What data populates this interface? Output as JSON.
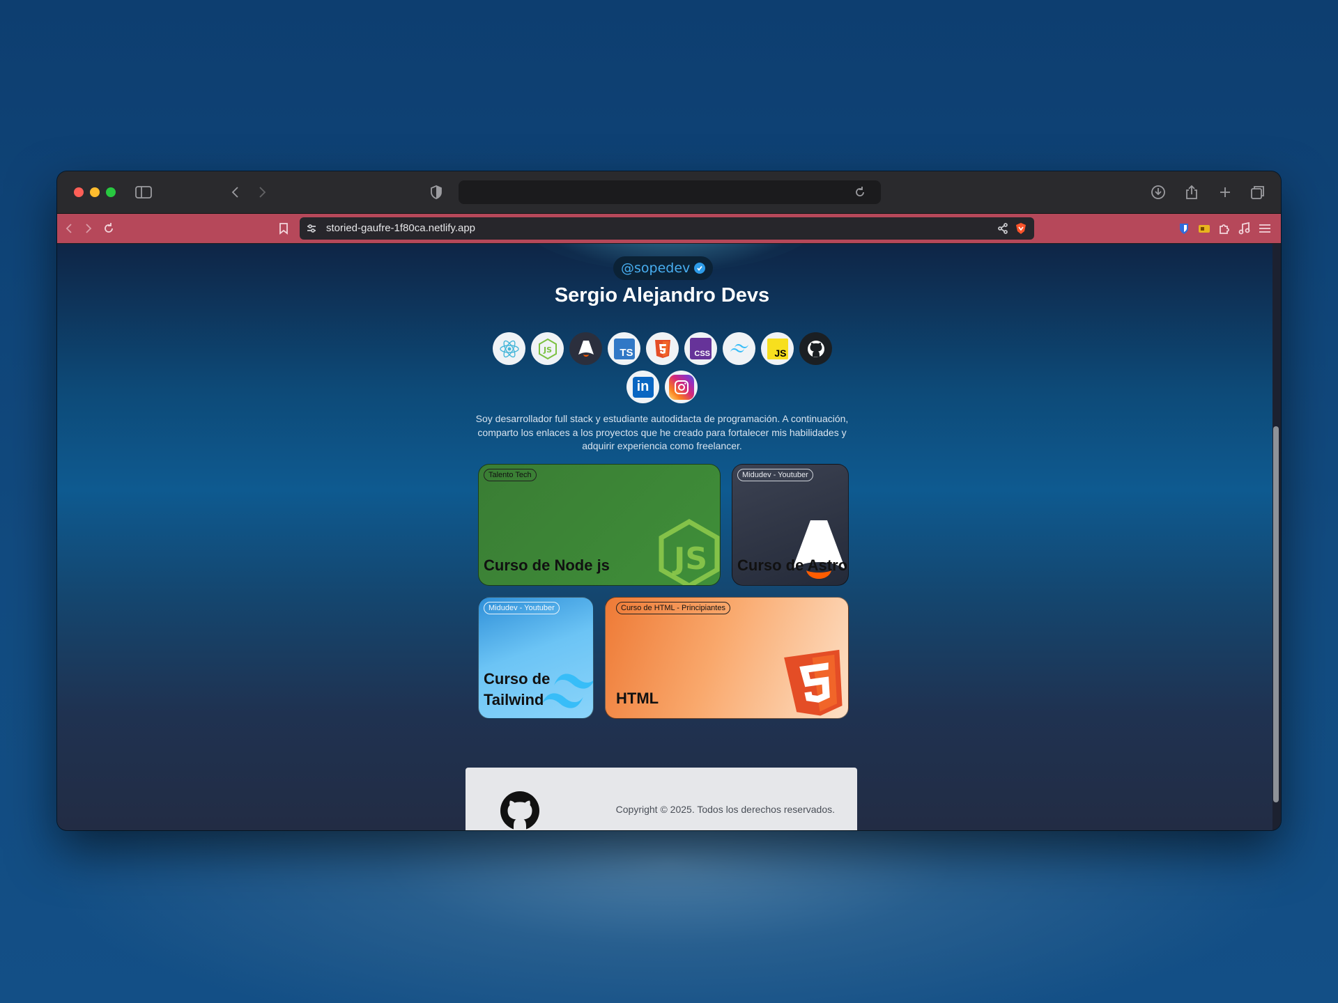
{
  "browser": {
    "url": "storied-gaufre-1f80ca.netlify.app"
  },
  "profile": {
    "handle": "@sopedev",
    "name": "Sergio Alejandro Devs",
    "bio": "Soy desarrollador full stack y estudiante autodidacta de programación. A continuación, comparto los enlaces a los proyectos que he creado para fortalecer mis habilidades y adquirir experiencia como freelancer."
  },
  "skills": [
    {
      "name": "react-icon",
      "label": ""
    },
    {
      "name": "nodejs-icon",
      "label": ""
    },
    {
      "name": "astro-icon",
      "label": ""
    },
    {
      "name": "typescript-icon",
      "label": "TS"
    },
    {
      "name": "html5-icon",
      "label": ""
    },
    {
      "name": "css-icon",
      "label": "CSS"
    },
    {
      "name": "tailwind-icon",
      "label": ""
    },
    {
      "name": "javascript-icon",
      "label": "JS"
    },
    {
      "name": "github-icon",
      "label": ""
    },
    {
      "name": "linkedin-icon",
      "label": "in"
    },
    {
      "name": "instagram-icon",
      "label": ""
    }
  ],
  "cards": [
    {
      "tag": "Talento Tech",
      "title": "Curso de Node js"
    },
    {
      "tag": "Midudev - Youtuber",
      "title": "Curso de Astro"
    },
    {
      "tag": "Midudev - Youtuber",
      "title_line1": "Curso de",
      "title_line2": "Tailwind"
    },
    {
      "tag": "Curso de HTML - Principiantes",
      "title": "HTML"
    }
  ],
  "footer": {
    "copyright": "Copyright © 2025. Todos los derechos reservados."
  },
  "colors": {
    "toolbar": "#b6485a",
    "accent_handle": "#48aef0",
    "node_green": "#3c8c3a",
    "html_orange": "#e44d26"
  }
}
